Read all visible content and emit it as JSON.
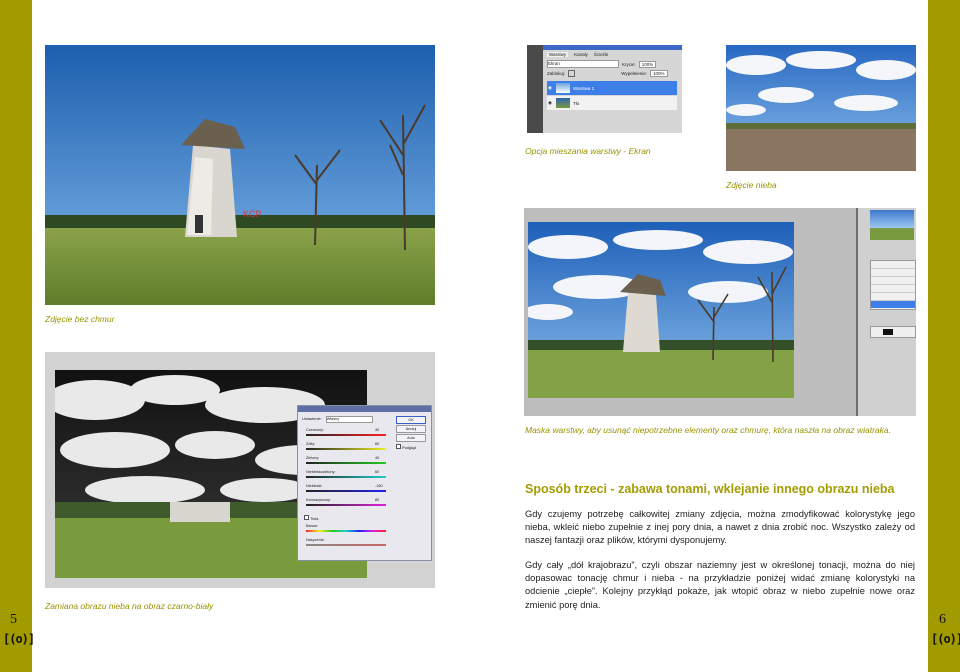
{
  "page": {
    "left_number": "5",
    "right_number": "6",
    "logo_text": "[(o)]"
  },
  "captions": {
    "no_clouds": "Zdjęcie bez chmur",
    "blend_mode": "Opcja mieszania warstwy - Ekran",
    "sky_photo": "Zdjęcie nieba",
    "mask": "Maska warstwy, aby usunąć niepotrzebne elementy oraz chmurę, która naszła na obraz wiatraka.",
    "bw_sky": "Zamiana obrazu nieba na obraz czarno-biały"
  },
  "article": {
    "title": "Sposób trzeci - zabawa tonami, wklejanie innego obrazu nieba",
    "paragraph1": "Gdy czujemy potrzebę całkowitej zmiany zdjęcia, można zmodyfikować kolorystykę jego nieba, wkleić niebo zupełnie z inej pory dnia, a nawet z dnia zrobić noc. Wszystko zależy od naszej fantazji oraz plików, którymi dysponujemy.",
    "paragraph2": "Gdy cały „dół krajobrazu”, czyli obszar naziemny jest w określonej tonacji, można do niej dopasowac tonację chmur i nieba - na przykładzie poniżej widać zmianę kolorystyki na odcienie „ciepłe”. Kolejny przykłąd pokaże, jak wtopić obraz w niebo zupełnie nowe oraz zmienić porę dnia."
  },
  "layers_panel": {
    "tab_layers": "Warstwy",
    "tab_channels": "Kanały",
    "tab_paths": "Ścieżki",
    "blend_mode": "Ekran",
    "opacity_label": "Krycie:",
    "opacity_value": "100%",
    "lock_label": "Zablokuj:",
    "fill_label": "Wypełnienie:",
    "fill_value": "100%",
    "layer_top": "Warstwa 1",
    "layer_bottom": "Tło"
  },
  "channel_mixer": {
    "preset_label": "Ustawienie:",
    "preset_value": "Własny",
    "ok_label": "OK",
    "cancel_label": "Anuluj",
    "auto_label": "Auto",
    "preview_label": "Podgląd",
    "red_label": "Czerwony:",
    "red_value": "40",
    "yellow_label": "Żółty:",
    "yellow_value": "60",
    "green_label": "Zielony:",
    "green_value": "40",
    "cyan_label": "Niebieskozielony:",
    "cyan_value": "60",
    "blue_label": "Niebieski:",
    "blue_value": "-160",
    "magenta_label": "Karmazynowy:",
    "magenta_value": "80",
    "tint_label": "Tinta",
    "hue_label": "Barwa:",
    "sat_label": "Nasycenie:",
    "percent": "%"
  },
  "colors": {
    "olive_band": "#a19b00",
    "accent_text": "#a49c00",
    "body_text": "#222222"
  }
}
